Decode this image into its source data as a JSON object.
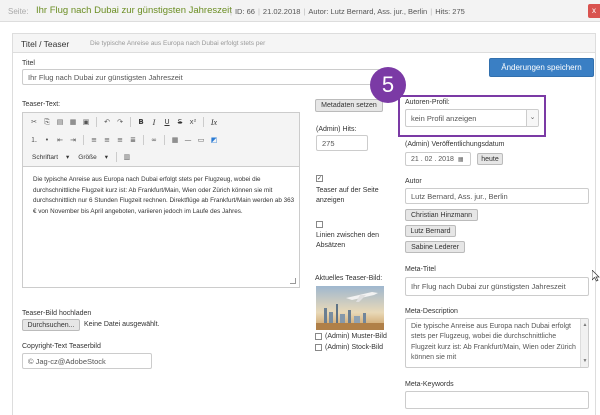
{
  "topbar": {
    "seite_label": "Seite:",
    "page_title": "Ihr Flug nach Dubai zur günstigsten Jahreszeit",
    "id": "ID: 66",
    "date": "21.02.2018",
    "author": "Autor: Lutz Bernard, Ass. jur., Berlin",
    "hits": "Hits: 275",
    "close_label": "x"
  },
  "panel": {
    "heading": "Titel / Teaser",
    "subheading": "Die typische Anreise aus Europa nach Dubai erfolgt stets per"
  },
  "title_field": {
    "label": "Titel",
    "value": "Ihr Flug nach Dubai zur günstigsten Jahreszeit"
  },
  "save_button": "Änderungen speichern",
  "teaser": {
    "label": "Teaser-Text:",
    "font_select": "Schriftart",
    "size_select": "Größe",
    "text": "Die typische Anreise aus Europa nach Dubai erfolgt stets per Flugzeug, wobei die durchschnittliche Flugzeit kurz ist: Ab Frankfurt/Main, Wien oder Zürich können sie mit durchschnittlich nur 6 Stunden Flugzeit rechnen. Direktflüge ab Frankfurt/Main werden ab 363 € von November bis April angeboten, variieren jedoch im Laufe des Jahres."
  },
  "metadata_button": "Metadaten setzen",
  "admin_hits": {
    "label": "(Admin) Hits:",
    "value": "275"
  },
  "teaser_top": {
    "label": "Teaser auf der Seite anzeigen",
    "checked": true
  },
  "linien": {
    "label": "Linien zwischen den Absätzen",
    "checked": false
  },
  "teaser_image": {
    "label": "Aktuelles Teaser-Bild:"
  },
  "muster_bild": "(Admin) Muster-Bild",
  "stock_bild": "(Admin) Stock-Bild",
  "upload": {
    "label": "Teaser-Bild hochladen",
    "button": "Durchsuchen...",
    "status": "Keine Datei ausgewählt."
  },
  "copyright": {
    "label": "Copyright-Text Teaserbild",
    "value": "© Jag-cz@AdobeStock"
  },
  "author_profile": {
    "label": "Autoren-Profil:",
    "selected": "kein Profil anzeigen"
  },
  "step_badge": "5",
  "publish_date": {
    "label": "(Admin) Veröffentlichungsdatum",
    "day": "21",
    "month": "02",
    "year": "2018",
    "today_button": "heute"
  },
  "author": {
    "label": "Autor",
    "value": "Lutz Bernard, Ass. jur., Berlin",
    "suggestions": [
      "Christian Hinzmann",
      "Lutz Bernard",
      "Sabine Lederer"
    ]
  },
  "meta_title": {
    "label": "Meta-Titel",
    "value": "Ihr Flug nach Dubai zur günstigsten Jahreszeit"
  },
  "meta_description": {
    "label": "Meta-Description",
    "value": "Die typische Anreise aus Europa nach Dubai erfolgt stets per Flugzeug, wobei die durchschnittliche Flugzeit kurz ist: Ab Frankfurt/Main, Wien oder Zürich können sie mit"
  },
  "meta_keywords": {
    "label": "Meta-Keywords",
    "value": ""
  },
  "colors": {
    "accent_purple": "#7b3aa5",
    "primary_blue": "#3a7fc4",
    "title_green": "#6b8e23",
    "close_red": "#d9534f"
  }
}
